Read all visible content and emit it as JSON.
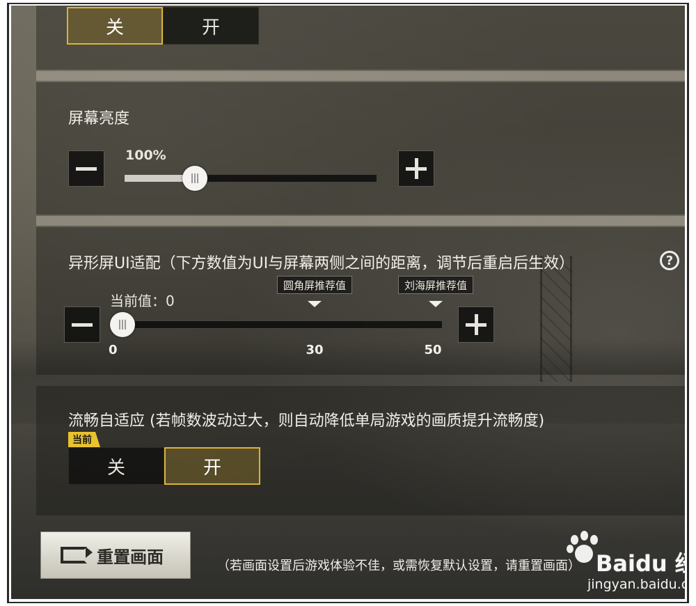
{
  "toggle_top": {
    "off_label": "关",
    "on_label": "开",
    "selected": "off"
  },
  "brightness": {
    "title": "屏幕亮度",
    "value_label": "100%",
    "level": 0.28,
    "minus_icon": "minus-icon",
    "plus_icon": "plus-icon"
  },
  "notch": {
    "title": "异形屏UI适配（下方数值为UI与屏幕两侧之间的距离，调节后重启后生效）",
    "help_icon": "question-circle-icon",
    "help_glyph": "?",
    "current_label": "当前值：0",
    "min": 0,
    "max": 50,
    "value": 0,
    "tick_labels": [
      "0",
      "30",
      "50"
    ],
    "markers": [
      {
        "label": "圆角屏推荐值",
        "value": 30
      },
      {
        "label": "刘海屏推荐值",
        "value": 50
      }
    ]
  },
  "adaptive": {
    "title": "流畅自适应 (若帧数波动过大，则自动降低单局游戏的画质提升流畅度)",
    "badge": "当前",
    "off_label": "关",
    "on_label": "开",
    "selected": "on"
  },
  "reset": {
    "label": "重置画面",
    "note": "（若画面设置后游戏体验不佳，或需恢复默认设置，请重置画面）",
    "icon": "reset-icon"
  },
  "watermark": {
    "brand": "Baidu 经验",
    "url": "jingyan.baidu.com"
  },
  "colors": {
    "accent": "#d9b43a",
    "badge": "#e9c22f"
  }
}
